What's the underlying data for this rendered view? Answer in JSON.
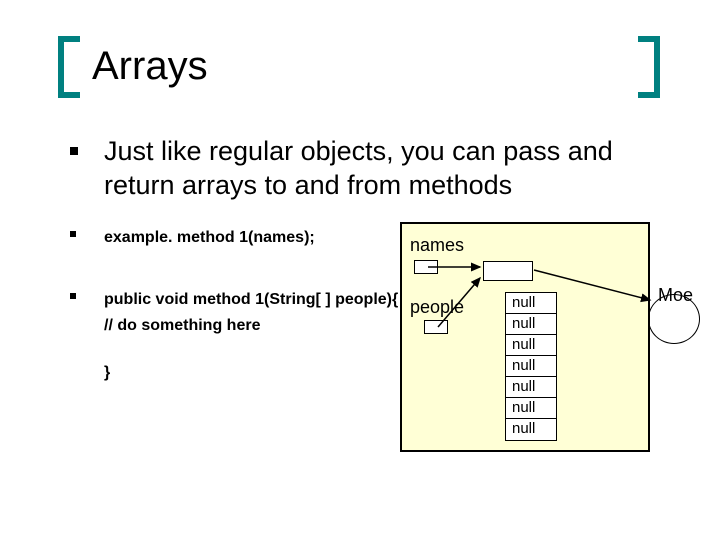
{
  "title": "Arrays",
  "main_bullet": "Just like regular objects, you can pass and return arrays to and from methods",
  "code": {
    "line1": "example. method 1(names);",
    "line2a": "public void method 1(String[ ] people){",
    "line2b": "// do something here",
    "line2c": "}"
  },
  "diagram": {
    "names_label": "names",
    "people_label": "people",
    "moe_label": "Moe",
    "nulls": [
      "null",
      "null",
      "null",
      "null",
      "null",
      "null",
      "null"
    ]
  }
}
